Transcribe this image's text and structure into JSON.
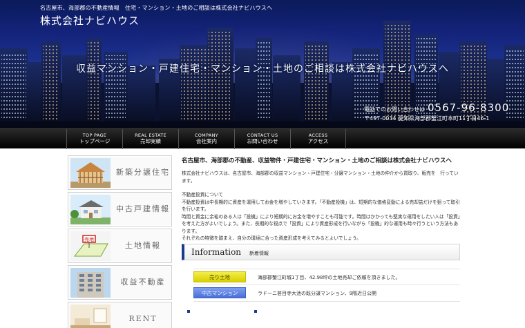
{
  "header": {
    "tagline": "名古屋市、海部郡の不動産情報　住宅・マンション・土地のご相談は株式会社ナビハウスへ",
    "logo": "株式会社ナビハウス",
    "hero_catch": "収益マンション・戸建住宅・マンション・土地のご相談は株式会社ナビハウスへ",
    "phone_label": "電話でのお問い合わせは",
    "phone_number": "0567-96-8300",
    "address": "〒497-0034 愛知県海部郡蟹江町本町11丁目46-1"
  },
  "nav": [
    {
      "en": "TOP PAGE",
      "ja": "トップページ"
    },
    {
      "en": "REAL ESTATE",
      "ja": "売却実績"
    },
    {
      "en": "COMPANY",
      "ja": "会社案内"
    },
    {
      "en": "CONTACT US",
      "ja": "お問い合わせ"
    },
    {
      "en": "ACCESS",
      "ja": "アクセス"
    }
  ],
  "sidebar": [
    {
      "label": "新築分譲住宅",
      "icon": "construction-house-icon"
    },
    {
      "label": "中古戸建情報",
      "icon": "house-icon"
    },
    {
      "label": "土地情報",
      "icon": "land-sale-icon"
    },
    {
      "label": "収益不動産",
      "icon": "apartment-building-icon"
    },
    {
      "label": "RENT",
      "icon": "rent-interior-icon"
    }
  ],
  "main": {
    "heading": "名古屋市、海部郡の不動産、収益物件・戸建住宅・マンション・土地のご相談は株式会社ナビハウスへ",
    "intro": "株式会社ナビハウスは、名古屋市、海部郡の収益マンション・戸建住宅・分譲マンション・土地の仲介から買取り、販売を　行っています。",
    "para_title": "不動産投資について",
    "para_lines": [
      "不動産投資は中長期的に資産を運用してお金を増やしていきます。「不動産投機」は、短期的な価格変動による売却益だけを狙って取引を行います。",
      "時間と資金に余裕のある人は「投機」により短期的にお金を増やすことも可能です。時間はかかっても堅実な運用をしたい人は「投資」を考えた方がよいでしょう。また、長期的な視点で「投資」により資産形成を行いながら「投機」的な運用も時々行うという方法もあります。",
      "それぞれの特徴を踏まえ、自分の環境に合った資産形成を考えてみるとよいでしょう。"
    ]
  },
  "information": {
    "title": "Information",
    "subtitle": "新着情報",
    "items": [
      {
        "badge": "売り土地",
        "text": "海部郡蟹江町城1丁目、42.98坪の土地売却ご依頼を頂きました。"
      },
      {
        "badge": "中古マンション",
        "text": "ラドーニ甚目寺大池の既分譲マンション、9階近日公開"
      }
    ]
  },
  "colors": {
    "nav_bg": "#000000",
    "accent_navy": "#1a3a8a",
    "badge_yellow": "#e6df1a",
    "badge_blue": "#5a7fe0"
  }
}
